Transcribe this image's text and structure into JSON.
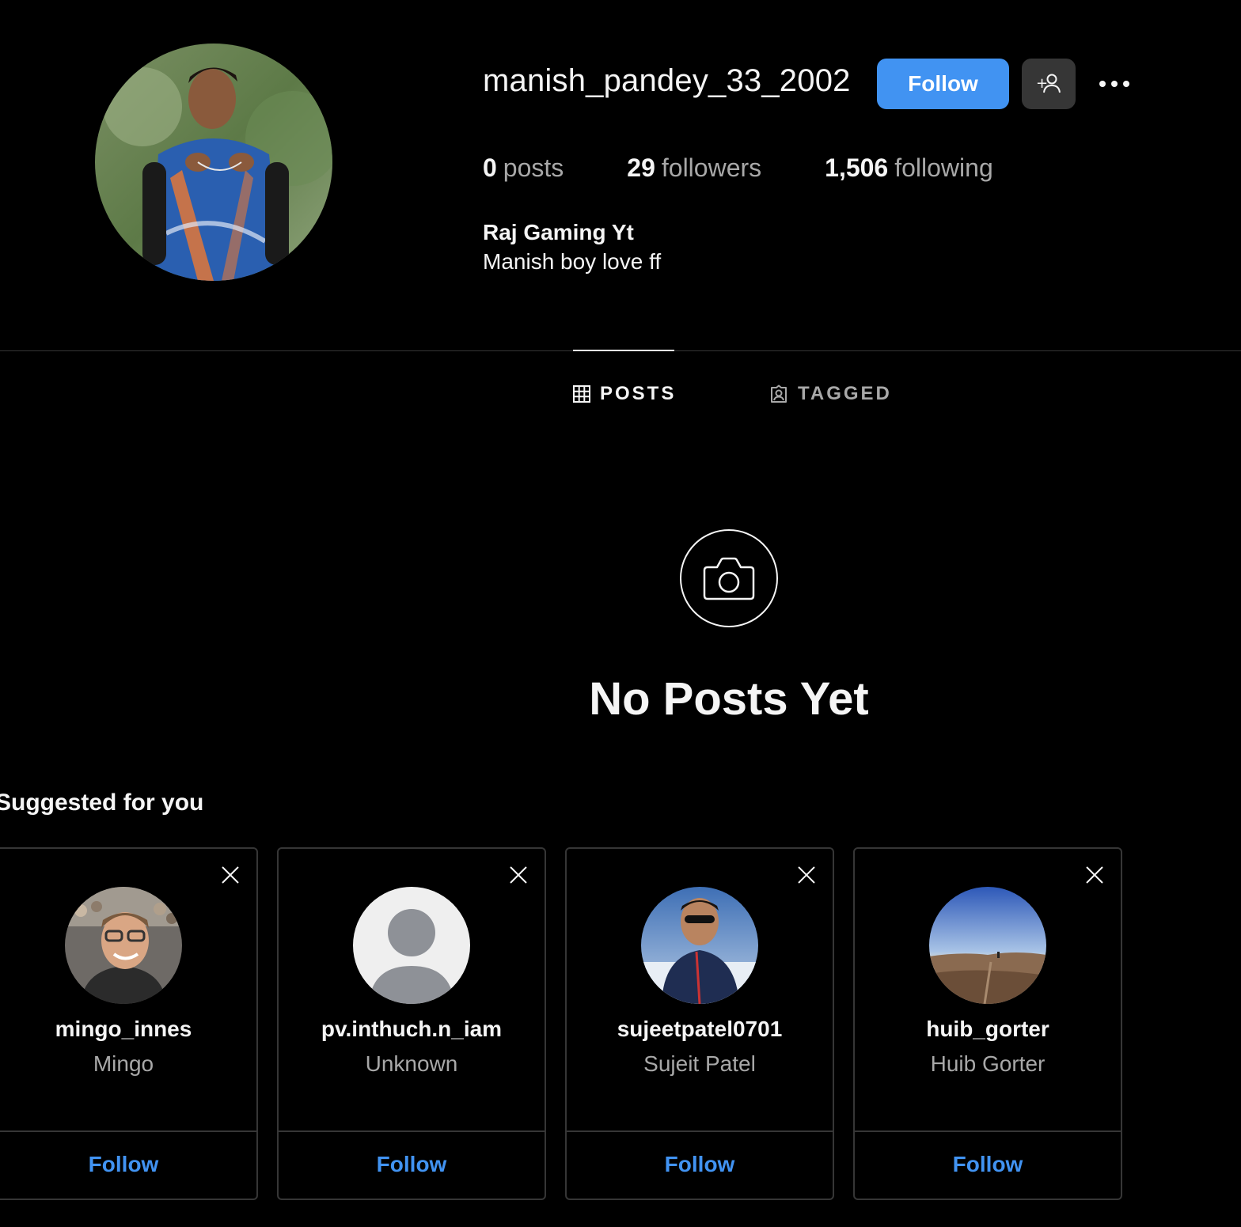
{
  "profile": {
    "username": "manish_pandey_33_2002",
    "follow_label": "Follow",
    "stats": {
      "posts_count": "0",
      "posts_label": "posts",
      "followers_count": "29",
      "followers_label": "followers",
      "following_count": "1,506",
      "following_label": "following"
    },
    "bio_name": "Raj Gaming Yt",
    "bio_text": "Manish boy love ff"
  },
  "tabs": [
    {
      "label": "POSTS",
      "icon": "grid-icon",
      "active": true
    },
    {
      "label": "TAGGED",
      "icon": "tagged-icon",
      "active": false
    }
  ],
  "empty_state": {
    "title": "No Posts Yet",
    "icon": "camera-icon"
  },
  "suggested": {
    "title": "Suggested for you",
    "cards": [
      {
        "username": "mingo_innes",
        "full_name": "Mingo",
        "follow_label": "Follow"
      },
      {
        "username": "pv.inthuch.n_iam",
        "full_name": "Unknown",
        "follow_label": "Follow"
      },
      {
        "username": "sujeetpatel0701",
        "full_name": "Sujeit Patel",
        "follow_label": "Follow"
      },
      {
        "username": "huib_gorter",
        "full_name": "Huib Gorter",
        "follow_label": "Follow"
      }
    ]
  },
  "colors": {
    "accent": "#4193f2",
    "background": "#000000",
    "muted": "#a8a8a8",
    "border": "#363636"
  }
}
